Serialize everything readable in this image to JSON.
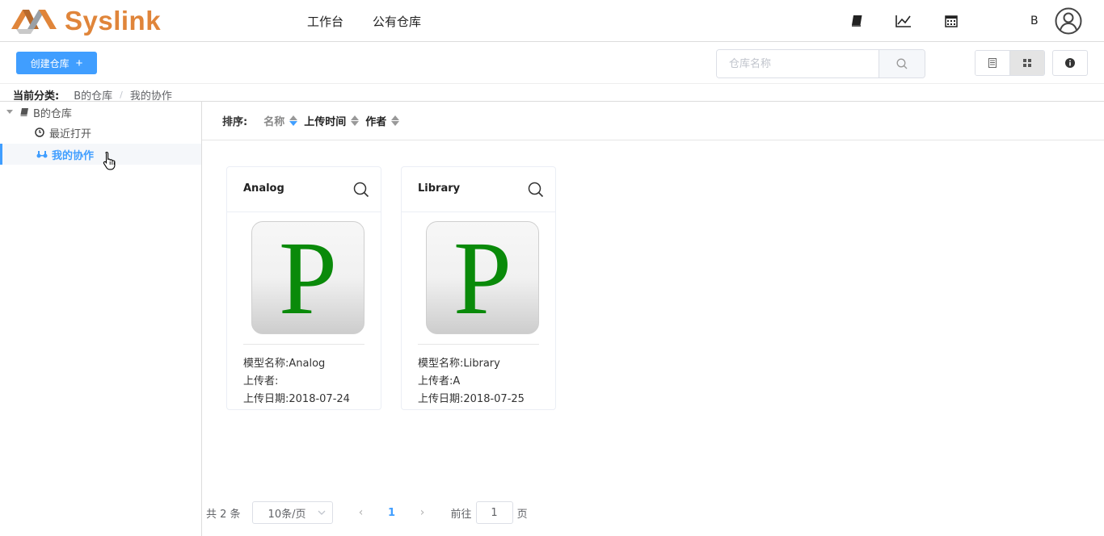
{
  "app": {
    "name": "Syslink",
    "brand_color": "#e0853a",
    "accent_color": "#409eff"
  },
  "topnav": {
    "items": [
      "工作台",
      "公有仓库"
    ]
  },
  "header_icons": [
    "book-icon",
    "line-chart-icon",
    "calendar-icon"
  ],
  "user": {
    "name": "B"
  },
  "toolbar": {
    "create_label": "创建仓库",
    "search_placeholder": "仓库名称"
  },
  "breadcrumb": {
    "label": "当前分类:",
    "items": [
      "B的仓库",
      "我的协作"
    ]
  },
  "tree": {
    "root": "B的仓库",
    "children": [
      "最近打开",
      "我的协作"
    ],
    "active": "我的协作"
  },
  "sort": {
    "title": "排序:",
    "fields": [
      "名称",
      "上传时间",
      "作者"
    ]
  },
  "cards": [
    {
      "title": "Analog",
      "thumb_letter": "P",
      "model_name": "模型名称:Analog",
      "uploader": "上传者:",
      "upload_date": "上传日期:2018-07-24"
    },
    {
      "title": "Library",
      "thumb_letter": "P",
      "model_name": "模型名称:Library",
      "uploader": "上传者:A",
      "upload_date": "上传日期:2018-07-25"
    }
  ],
  "pagination": {
    "total": "共 2 条",
    "page_size": "10条/页",
    "current_page": "1",
    "goto_label": "前往",
    "goto_value": "1",
    "page_suffix": "页"
  }
}
